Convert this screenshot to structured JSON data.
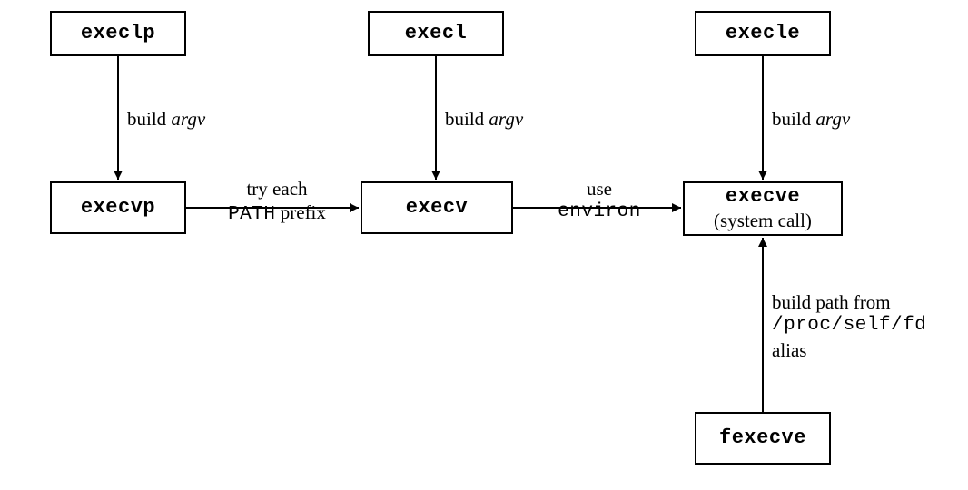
{
  "nodes": {
    "execlp": "execlp",
    "execl": "execl",
    "execle": "execle",
    "execvp": "execvp",
    "execv": "execv",
    "execve_name": "execve",
    "execve_sub": "(system call)",
    "fexecve": "fexecve"
  },
  "edges": {
    "build_argv_1_a": "build ",
    "build_argv_1_b": "argv",
    "build_argv_2_a": "build ",
    "build_argv_2_b": "argv",
    "build_argv_3_a": "build ",
    "build_argv_3_b": "argv",
    "try_each_a": "try each",
    "try_each_b": "PATH",
    "try_each_c": " prefix",
    "use_a": "use",
    "use_b": "environ",
    "buildpath_a": "build path from",
    "buildpath_b": "/proc/self/fd",
    "buildpath_c": "alias"
  }
}
